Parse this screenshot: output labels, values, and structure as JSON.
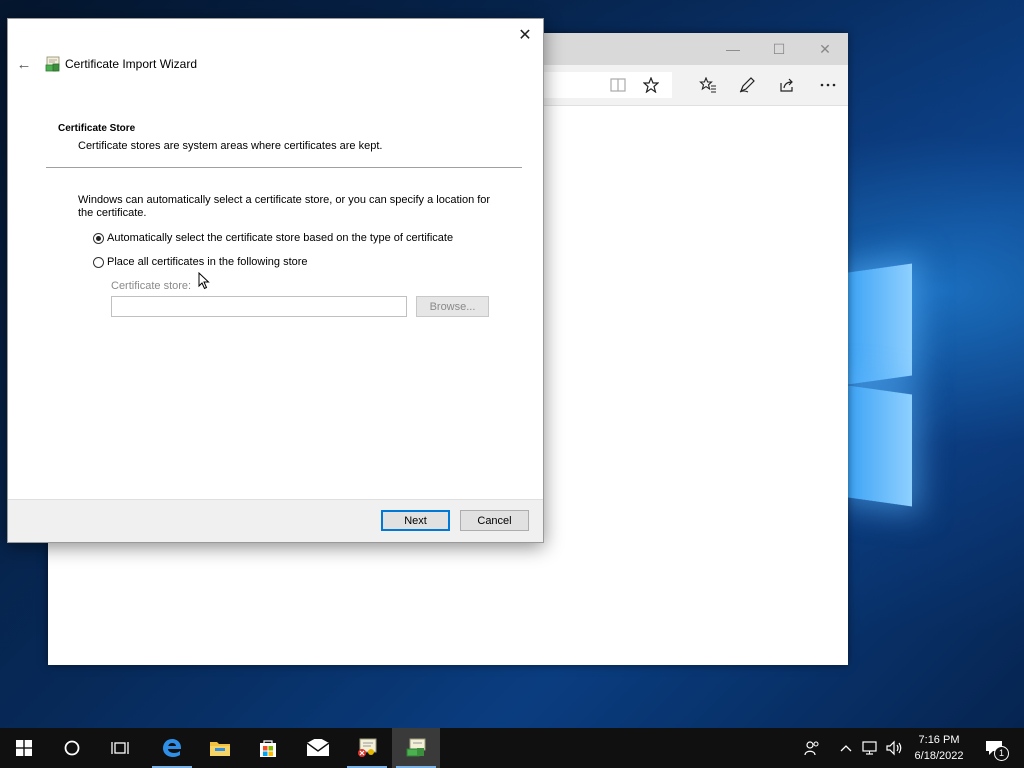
{
  "browser": {
    "minimize_glyph": "—",
    "maximize_glyph": "☐",
    "close_glyph": "✕",
    "toolbar_icons": [
      "reading-view-icon",
      "favorite-star-icon",
      "favorites-list-icon",
      "pen-icon",
      "share-icon",
      "more-icon"
    ]
  },
  "dialog": {
    "title": "Certificate Import Wizard",
    "close_glyph": "✕",
    "back_glyph": "←",
    "section_title": "Certificate Store",
    "section_description": "Certificate stores are system areas where certificates are kept.",
    "intro": "Windows can automatically select a certificate store, or you can specify a location for the certificate.",
    "option_auto": "Automatically select the certificate store based on the type of certificate",
    "option_manual": "Place all certificates in the following store",
    "selected_option": "auto",
    "store_label": "Certificate store:",
    "store_value": "",
    "browse_label": "Browse...",
    "next_label": "Next",
    "cancel_label": "Cancel"
  },
  "taskbar": {
    "items": [
      "start-icon",
      "cortana-icon",
      "task-view-icon",
      "edge-icon",
      "file-explorer-icon",
      "store-icon",
      "mail-icon",
      "certmgr-icon",
      "cert-wizard-icon"
    ],
    "clock_time": "7:16 PM",
    "clock_date": "6/18/2022",
    "notification_count": "1"
  },
  "colors": {
    "accent": "#0078d7",
    "taskbar": "#101010",
    "dialog_footer": "#f0f0f0"
  }
}
